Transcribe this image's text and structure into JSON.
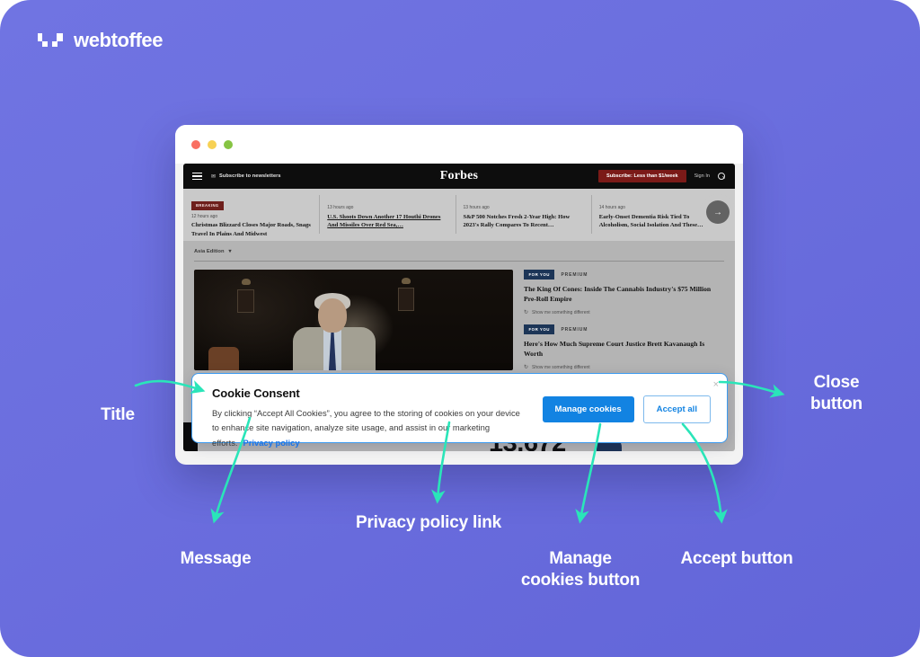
{
  "brand": {
    "name": "webtoffee",
    "logo_icon": "webtoffee-pixel-mark"
  },
  "background": {
    "color": "#6b6ede",
    "accent": "#2ae5b9"
  },
  "browser": {
    "traffic_lights": [
      "red",
      "yellow",
      "green"
    ]
  },
  "site": {
    "nav": {
      "menu_icon": "hamburger-icon",
      "mail_icon": "envelope-icon",
      "newsletter_label": "Subscribe to newsletters",
      "wordmark": "Forbes",
      "subscribe_label": "Subscribe: Less than $1/week",
      "signin_label": "Sign In",
      "search_icon": "search-icon"
    },
    "breaking_badge": "BREAKING",
    "headlines": [
      {
        "time": "12 hours ago",
        "title": "Christmas Blizzard Closes Major Roads, Snags Travel In Plains And Midwest",
        "underline": false
      },
      {
        "time": "13 hours ago",
        "title": "U.S. Shoots Down Another 17 Houthi Drones And Missiles Over Red Sea,…",
        "underline": true
      },
      {
        "time": "13 hours ago",
        "title": "S&P 500 Notches Fresh 2-Year High: How 2023's Rally Compares To Recent…",
        "underline": false
      },
      {
        "time": "14 hours ago",
        "title": "Early-Onset Dementia Risk Tied To Alcoholism, Social Isolation And These…",
        "underline": false
      }
    ],
    "next_arrow_icon": "arrow-right-icon",
    "edition": {
      "label": "Asia Edition",
      "chevron_icon": "chevron-down-icon"
    },
    "premium_cards": [
      {
        "tag": "FOR YOU",
        "kicker": "PREMIUM",
        "title": "The King Of Cones: Inside The Cannabis Industry's $75 Million Pre-Roll Empire",
        "alt_label": "Show me something different",
        "alt_icon": "refresh-icon"
      },
      {
        "tag": "FOR YOU",
        "kicker": "PREMIUM",
        "title": "Here's How Much Supreme Court Justice Brett Kavanaugh Is Worth",
        "alt_label": "Show me something different",
        "alt_icon": "refresh-icon"
      }
    ],
    "big_number": "13,672"
  },
  "cookie_banner": {
    "title": "Cookie Consent",
    "message": "By clicking “Accept All Cookies”, you agree to the storing of cookies on your device to enhance site navigation, analyze site usage, and assist in our marketing efforts.",
    "privacy_link": "Privacy policy",
    "manage_label": "Manage cookies",
    "accept_label": "Accept all",
    "close_icon": "close-icon",
    "close_glyph": "×",
    "colors": {
      "primary": "#1283e2",
      "border": "#3c9bf0"
    }
  },
  "annotations": {
    "title": "Title",
    "message": "Message",
    "privacy": "Privacy policy link",
    "manage": "Manage\ncookies button",
    "manage_line1": "Manage",
    "manage_line2": "cookies button",
    "accept": "Accept button",
    "close_line1": "Close",
    "close_line2": "button"
  }
}
